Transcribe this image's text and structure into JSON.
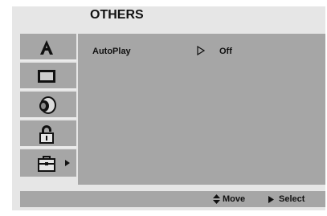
{
  "header": {
    "title": "OTHERS"
  },
  "sidebar": {
    "items": [
      {
        "icon": "language-a-icon"
      },
      {
        "icon": "display-icon"
      },
      {
        "icon": "audio-speaker-icon"
      },
      {
        "icon": "lock-icon"
      },
      {
        "icon": "others-bag-icon",
        "selected": true
      }
    ]
  },
  "main": {
    "rows": [
      {
        "label": "AutoPlay",
        "value": "Off"
      }
    ]
  },
  "footer": {
    "move_label": "Move",
    "select_label": "Select"
  },
  "colors": {
    "panel": "#a6a6a6",
    "background": "#e6e6e6",
    "text": "#111111"
  }
}
